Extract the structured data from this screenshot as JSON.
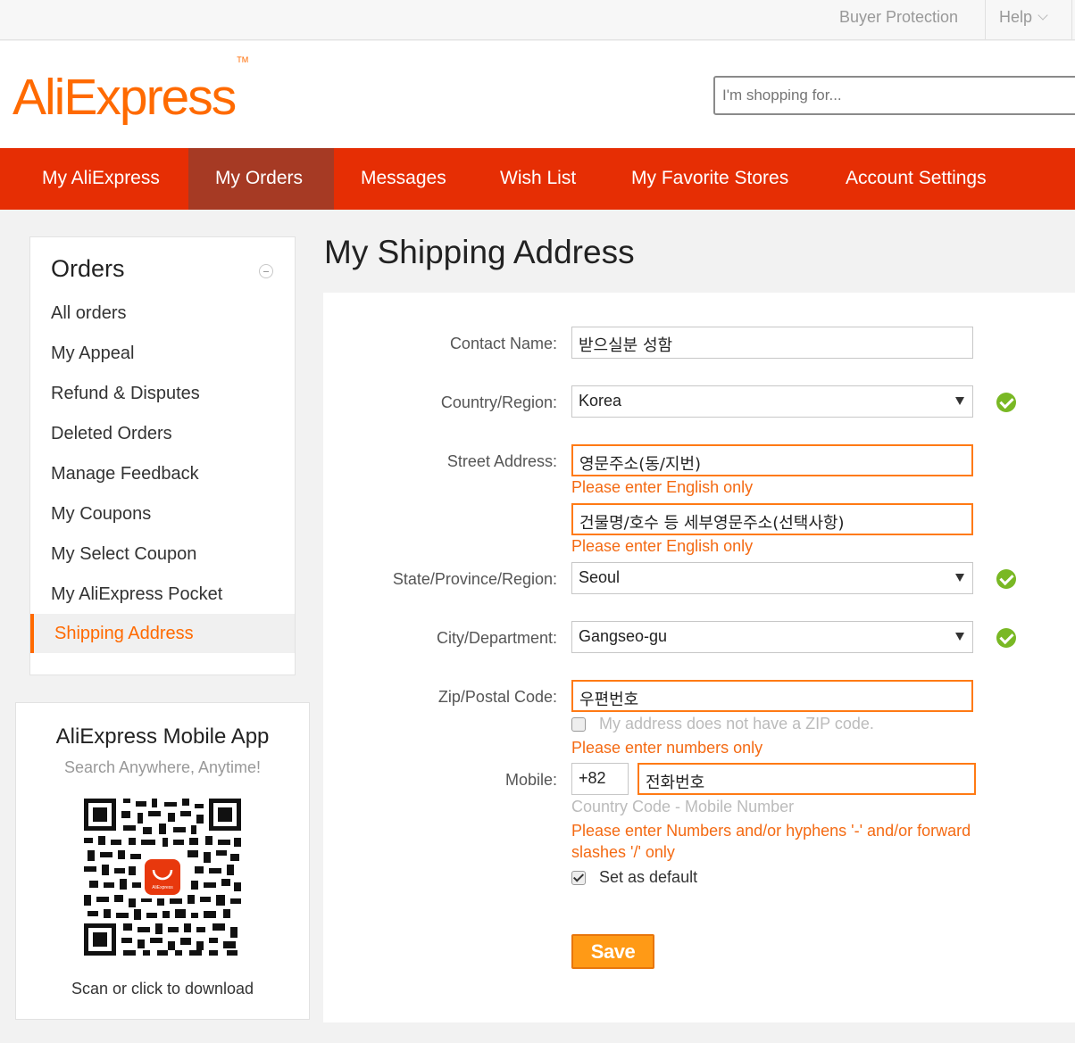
{
  "topbar": {
    "buyer_protection": "Buyer Protection",
    "help": "Help"
  },
  "header": {
    "logo_text": "AliExpress",
    "logo_tm": "TM",
    "search_placeholder": "I'm shopping for..."
  },
  "nav": {
    "items": [
      {
        "label": "My AliExpress"
      },
      {
        "label": "My Orders",
        "active": true
      },
      {
        "label": "Messages"
      },
      {
        "label": "Wish List"
      },
      {
        "label": "My Favorite Stores"
      },
      {
        "label": "Account Settings"
      }
    ]
  },
  "sidebar": {
    "title": "Orders",
    "items": [
      {
        "label": "All orders"
      },
      {
        "label": "My Appeal"
      },
      {
        "label": "Refund & Disputes"
      },
      {
        "label": "Deleted Orders"
      },
      {
        "label": "Manage Feedback"
      },
      {
        "label": "My Coupons"
      },
      {
        "label": "My Select Coupon"
      },
      {
        "label": "My AliExpress Pocket"
      },
      {
        "label": "Shipping Address",
        "active": true
      }
    ]
  },
  "app": {
    "title": "AliExpress Mobile App",
    "subtitle": "Search Anywhere, Anytime!",
    "footer": "Scan or click to download",
    "qr_label": "AliExpress"
  },
  "page_title": "My Shipping Address",
  "form": {
    "contact_name": {
      "label": "Contact Name:",
      "value": "받으실분 성함"
    },
    "country": {
      "label": "Country/Region:",
      "value": "Korea"
    },
    "street": {
      "label": "Street Address:",
      "value1": "영문주소(동/지번)",
      "error1": "Please enter English only",
      "value2": "건물명/호수 등 세부영문주소(선택사항)",
      "error2": "Please enter English only"
    },
    "state": {
      "label": "State/Province/Region:",
      "value": "Seoul"
    },
    "city": {
      "label": "City/Department:",
      "value": "Gangseo-gu"
    },
    "zip": {
      "label": "Zip/Postal Code:",
      "value": "우편번호",
      "no_zip_label": "My address does not have a ZIP code.",
      "error": "Please enter numbers only"
    },
    "mobile": {
      "label": "Mobile:",
      "country_code": "+82",
      "value": "전화번호",
      "hint": "Country Code - Mobile Number",
      "error_line1": "Please enter Numbers and/or hyphens '-' and/or forward",
      "error_line2": "slashes '/' only"
    },
    "default_label": "Set as default",
    "save_label": "Save"
  },
  "colors": {
    "brand": "#ff6a00",
    "nav_bg": "#e62e04",
    "nav_active": "#a63a24",
    "error": "#f46a13",
    "ok": "#79b824",
    "save": "#ff9a16"
  }
}
